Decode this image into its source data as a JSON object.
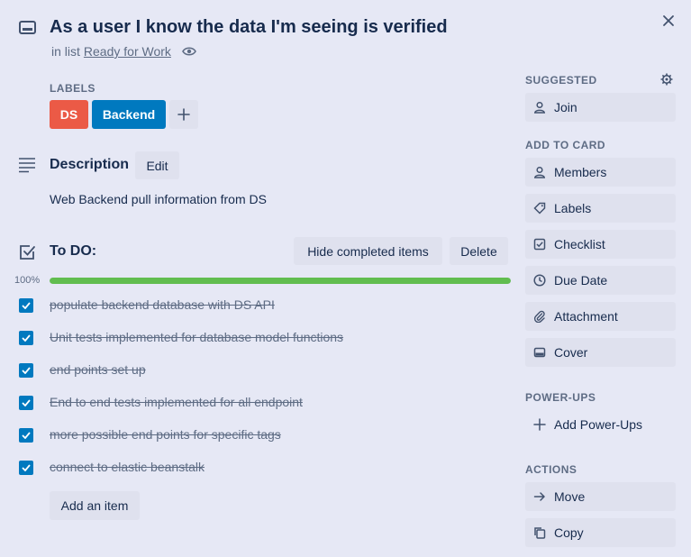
{
  "card": {
    "title": "As a user I know the data I'm seeing is verified",
    "list_prefix": "in list",
    "list_name": "Ready for Work"
  },
  "labels": {
    "heading": "LABELS",
    "items": [
      {
        "text": "DS",
        "color": "#eb5a46"
      },
      {
        "text": "Backend",
        "color": "#0079bf"
      }
    ]
  },
  "description": {
    "heading": "Description",
    "edit_label": "Edit",
    "text": "Web Backend pull information from DS"
  },
  "checklist": {
    "title": "To DO:",
    "hide_completed_label": "Hide completed items",
    "delete_label": "Delete",
    "progress_text": "100%",
    "progress": 1.0,
    "progress_color": "#61bd4f",
    "items": [
      {
        "text": "populate backend database with DS API",
        "checked": true
      },
      {
        "text": "Unit tests implemented for database model functions",
        "checked": true
      },
      {
        "text": "end points set up",
        "checked": true
      },
      {
        "text": "End to end tests implemented for all endpoint",
        "checked": true
      },
      {
        "text": "more possible end points for specific tags",
        "checked": true
      },
      {
        "text": "connect to elastic beanstalk",
        "checked": true
      }
    ],
    "add_item_label": "Add an item"
  },
  "sidebar": {
    "suggested_heading": "SUGGESTED",
    "join_label": "Join",
    "add_to_card_heading": "ADD TO CARD",
    "add_to_card": [
      {
        "label": "Members",
        "icon": "person-icon"
      },
      {
        "label": "Labels",
        "icon": "tag-icon"
      },
      {
        "label": "Checklist",
        "icon": "checkbox-icon"
      },
      {
        "label": "Due Date",
        "icon": "clock-icon"
      },
      {
        "label": "Attachment",
        "icon": "paperclip-icon"
      },
      {
        "label": "Cover",
        "icon": "cover-icon"
      }
    ],
    "powerups_heading": "POWER-UPS",
    "add_powerups_label": "Add Power-Ups",
    "actions_heading": "ACTIONS",
    "actions": [
      {
        "label": "Move",
        "icon": "arrow-right-icon"
      },
      {
        "label": "Copy",
        "icon": "copy-icon"
      }
    ]
  }
}
